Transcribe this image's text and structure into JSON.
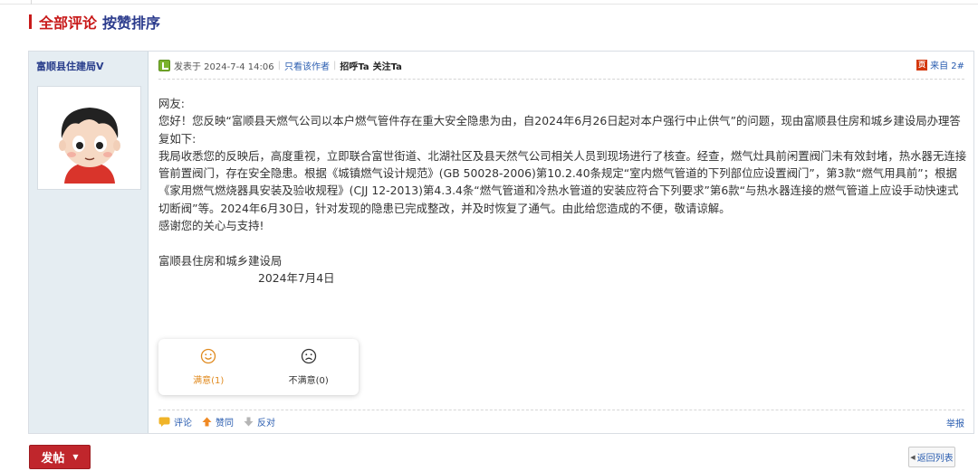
{
  "section": {
    "title_all": "全部评论",
    "title_sort": "按赞排序"
  },
  "post": {
    "author": "富顺县住建局",
    "author_badge": "V",
    "meta_posted": "发表于 2024-7-4 14:06",
    "meta_only_author": "只看该作者",
    "meta_greet": "招呼Ta",
    "meta_follow": "关注Ta",
    "origin_badge": "页",
    "origin_text": "来自 2#",
    "body": {
      "line1": "网友:",
      "line2": "您好！您反映“富顺县天燃气公司以本户燃气管件存在重大安全隐患为由，自2024年6月26日起对本户强行中止供气”的问题，现由富顺县住房和城乡建设局办理答复如下:",
      "line3": "我局收悉您的反映后，高度重视，立即联合富世街道、北湖社区及县天然气公司相关人员到现场进行了核查。经查，燃气灶具前闲置阀门未有效封堵，热水器无连接管前置阀门，存在安全隐患。根据《城镇燃气设计规范》(GB 50028-2006)第10.2.40条规定“室内燃气管道的下列部位应设置阀门”，第3款“燃气用具前”；根据《家用燃气燃烧器具安装及验收规程》(CJJ 12-2013)第4.3.4条“燃气管道和冷热水管道的安装应符合下列要求”第6款“与热水器连接的燃气管道上应设手动快速式切断阀”等。2024年6月30日，针对发现的隐患已完成整改，并及时恢复了通气。由此给您造成的不便，敬请谅解。",
      "line4": "感谢您的关心与支持!",
      "signature": "富顺县住房和城乡建设局",
      "date": "2024年7月4日"
    },
    "vote": {
      "satisfied": "满意(1)",
      "unsatisfied": "不满意(0)"
    },
    "actions": {
      "comment": "评论",
      "like": "赞同",
      "oppose": "反对",
      "report": "举报"
    }
  },
  "footer": {
    "post_button": "发帖",
    "back_button": "返回列表"
  },
  "colors": {
    "accent_red": "#c81a1a",
    "link_blue": "#2a5db0",
    "sidebar_bg": "#e5edf2",
    "satisfied_orange": "#e08a1e"
  }
}
